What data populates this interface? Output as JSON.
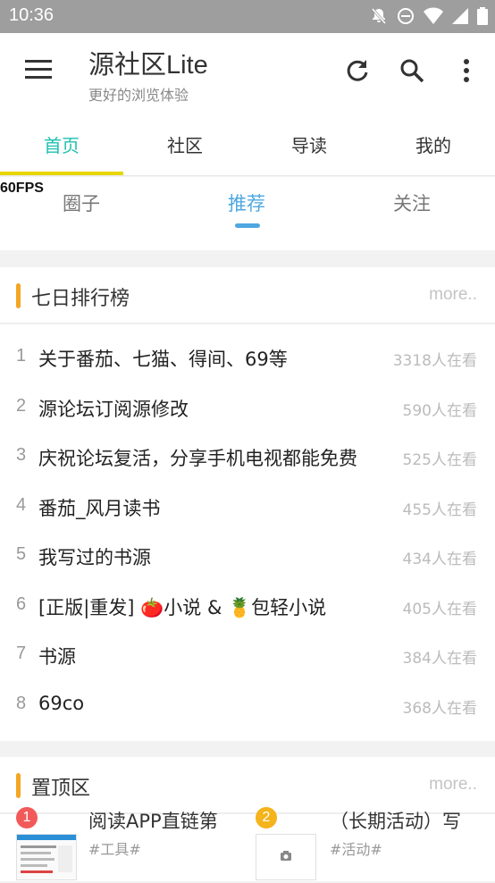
{
  "status_bar": {
    "time": "10:36",
    "icons": [
      "notifications-off-icon",
      "do-not-disturb-icon",
      "wifi-icon",
      "signal-icon",
      "battery-icon"
    ]
  },
  "appbar": {
    "title": "源社区Lite",
    "subtitle": "更好的浏览体验",
    "icons": [
      "menu-icon",
      "refresh-icon",
      "search-icon",
      "more-vert-icon"
    ]
  },
  "main_tabs": [
    {
      "label": "首页",
      "active": true
    },
    {
      "label": "社区",
      "active": false
    },
    {
      "label": "导读",
      "active": false
    },
    {
      "label": "我的",
      "active": false
    }
  ],
  "fps_overlay": "60FPS",
  "sub_tabs": [
    {
      "label": "圈子",
      "active": false
    },
    {
      "label": "推荐",
      "active": true
    },
    {
      "label": "关注",
      "active": false
    }
  ],
  "ranking": {
    "title": "七日排行榜",
    "more": "more..",
    "items": [
      {
        "rank": "1",
        "title": "关于番茄、七猫、得间、69等",
        "views": "3318人在看"
      },
      {
        "rank": "2",
        "title": "源论坛订阅源修改",
        "views": "590人在看"
      },
      {
        "rank": "3",
        "title": "庆祝论坛复活，分享手机电视都能免费",
        "views": "525人在看"
      },
      {
        "rank": "4",
        "title": "番茄_风月读书",
        "views": "455人在看"
      },
      {
        "rank": "5",
        "title": "我写过的书源",
        "views": "434人在看"
      },
      {
        "rank": "6",
        "title": "[正版|重发] 🍅小说 & 🍍包轻小说",
        "views": "405人在看"
      },
      {
        "rank": "7",
        "title": "书源",
        "views": "384人在看"
      },
      {
        "rank": "8",
        "title": "69co",
        "views": "368人在看"
      }
    ]
  },
  "pinned": {
    "title": "置顶区",
    "more": "more..",
    "items": [
      {
        "badge": "1",
        "title": "阅读APP直链第",
        "tag": "#工具#",
        "badge_color": "#f25a5a"
      },
      {
        "badge": "2",
        "title": "（长期活动）写",
        "tag": "#活动#",
        "badge_color": "#f5b31c"
      }
    ]
  },
  "colors": {
    "accent_teal": "#1ec0b0",
    "accent_blue": "#4ea8e0",
    "indicator_yellow": "#e8d600",
    "section_orange": "#f5a623"
  }
}
